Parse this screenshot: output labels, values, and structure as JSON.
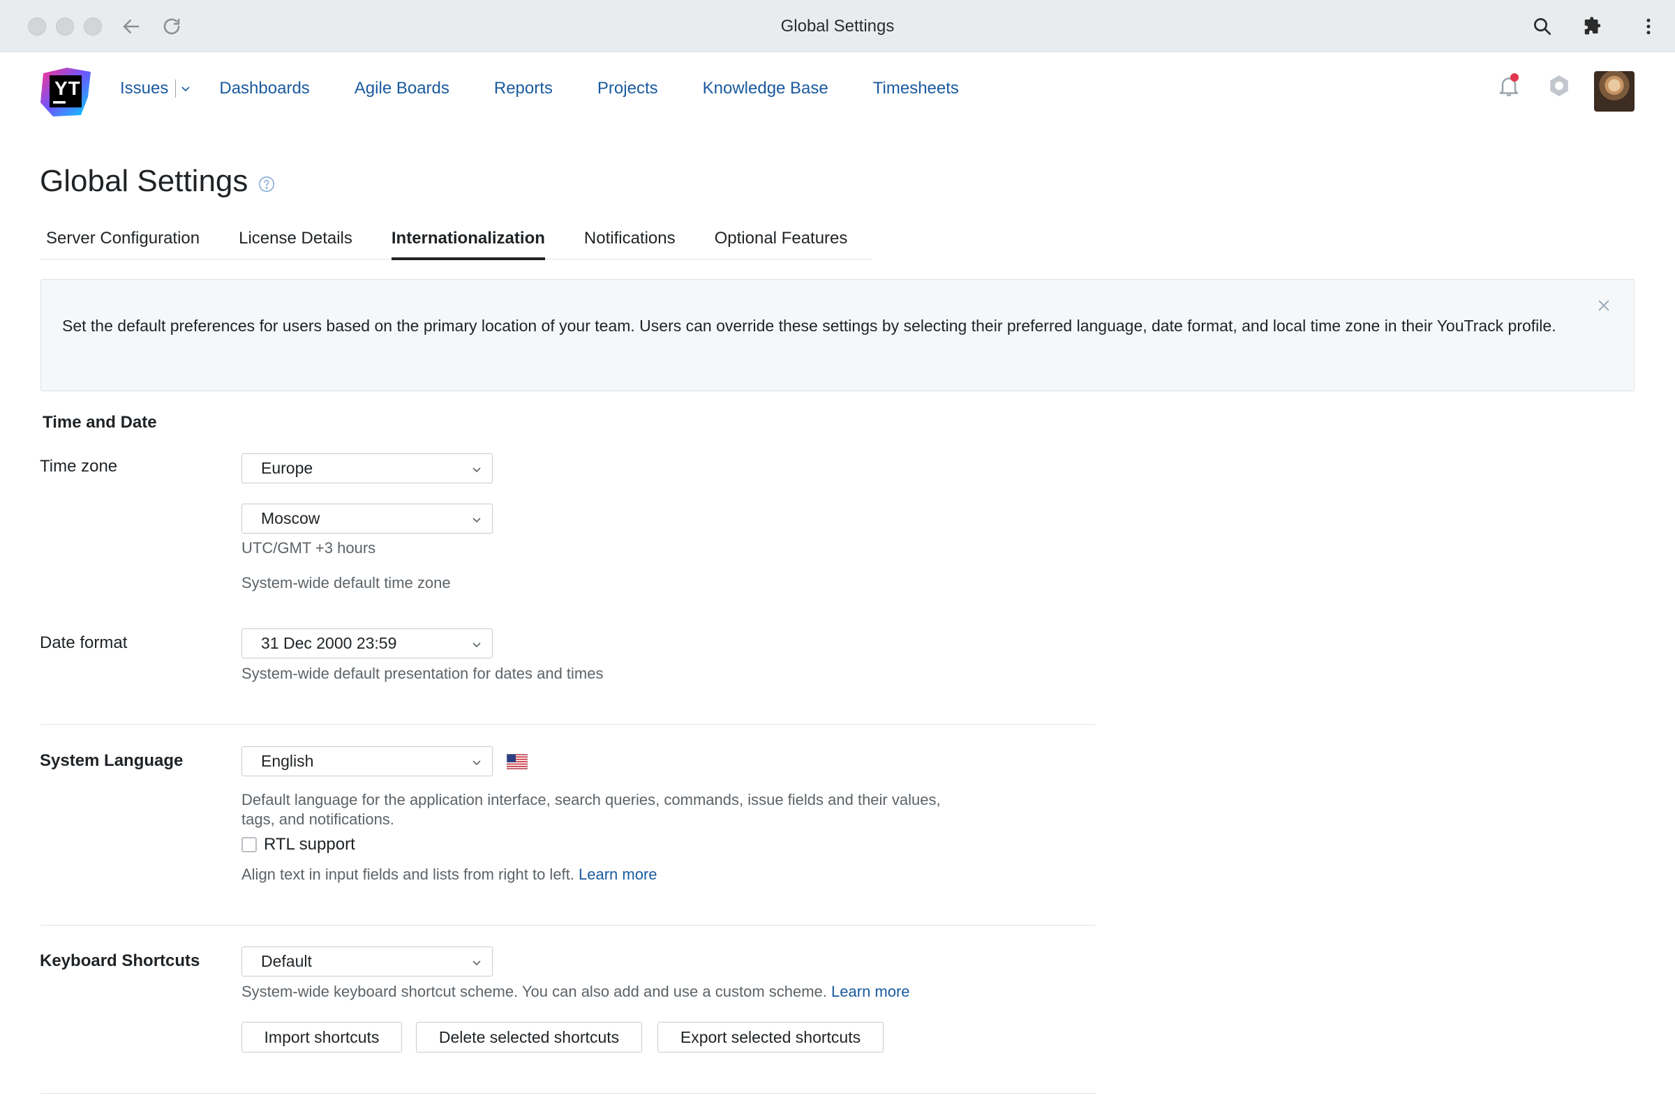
{
  "browser": {
    "title": "Global Settings"
  },
  "nav": {
    "items": [
      "Issues",
      "Dashboards",
      "Agile Boards",
      "Reports",
      "Projects",
      "Knowledge Base",
      "Timesheets"
    ]
  },
  "logo": {
    "text": "YT"
  },
  "page": {
    "title": "Global Settings"
  },
  "tabs": [
    "Server Configuration",
    "License Details",
    "Internationalization",
    "Notifications",
    "Optional Features"
  ],
  "active_tab": "Internationalization",
  "banner": {
    "text": "Set the default preferences for users based on the primary location of your team. Users can override these settings by selecting their preferred language, date format, and local time zone in their YouTrack profile."
  },
  "time_and_date": {
    "section_title": "Time and Date",
    "time_zone_label": "Time zone",
    "region_value": "Europe",
    "city_value": "Moscow",
    "utc_offset": "UTC/GMT +3 hours",
    "time_zone_hint": "System-wide default time zone",
    "date_format_label": "Date format",
    "date_format_value": "31 Dec 2000 23:59",
    "date_format_hint": "System-wide default presentation for dates and times"
  },
  "system_language": {
    "section_title": "System Language",
    "value": "English",
    "hint_line1": "Default language for the application interface, search queries, commands, issue fields and their values,",
    "hint_line2": "tags, and notifications.",
    "rtl_label": "RTL support",
    "rtl_checked": false,
    "rtl_hint": "Align text in input fields and lists from right to left.",
    "learn_more": "Learn more"
  },
  "keyboard_shortcuts": {
    "section_title": "Keyboard Shortcuts",
    "value": "Default",
    "hint": "System-wide keyboard shortcut scheme. You can also add and use a custom scheme.",
    "learn_more": "Learn more",
    "buttons": {
      "import": "Import shortcuts",
      "delete": "Delete selected shortcuts",
      "export": "Export selected shortcuts"
    }
  },
  "icons": {
    "back": "arrow-left-icon",
    "reload": "reload-icon",
    "search": "search-icon",
    "extensions": "puzzle-icon",
    "menu": "kebab-menu-icon",
    "notifications": "bell-icon",
    "settings": "gear-icon",
    "help": "help-circle-icon",
    "close": "close-icon",
    "chevron": "chevron-down-icon",
    "flag": "us-flag-icon"
  },
  "colors": {
    "link": "#1a5a9e",
    "notification_dot": "#e0364c",
    "chrome_bg": "#e9ecee"
  }
}
